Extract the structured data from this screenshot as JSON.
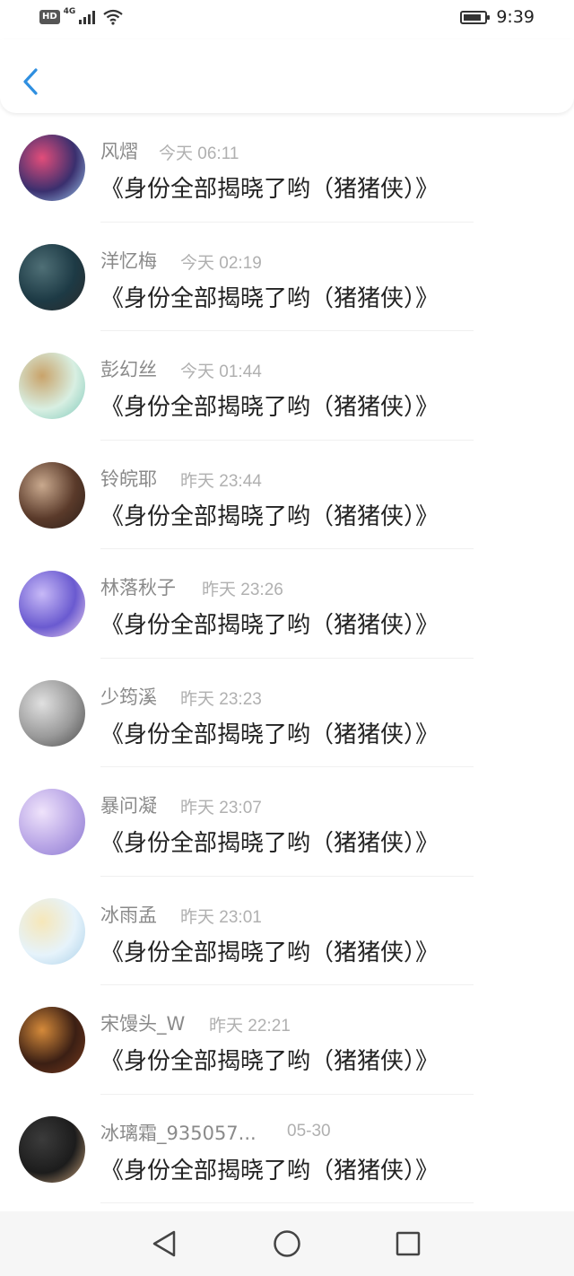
{
  "status_bar": {
    "hd_label": "HD",
    "network_type": "4G",
    "battery_level": 0.85,
    "time": "9:39"
  },
  "header": {
    "back_icon": "chevron-left-icon",
    "accent_color": "#2f8fe0"
  },
  "list": [
    {
      "name": "风熠",
      "time": "今天 06:11",
      "message": "《身份全部揭晓了哟（猪猪侠）》"
    },
    {
      "name": "洋忆梅",
      "time": "今天 02:19",
      "message": "《身份全部揭晓了哟（猪猪侠）》"
    },
    {
      "name": "彭幻丝",
      "time": "今天 01:44",
      "message": "《身份全部揭晓了哟（猪猪侠）》"
    },
    {
      "name": "铃皖耶",
      "time": "昨天 23:44",
      "message": "《身份全部揭晓了哟（猪猪侠）》"
    },
    {
      "name": "林落秋子",
      "time": "昨天 23:26",
      "message": "《身份全部揭晓了哟（猪猪侠）》"
    },
    {
      "name": "少筠溪",
      "time": "昨天 23:23",
      "message": "《身份全部揭晓了哟（猪猪侠）》"
    },
    {
      "name": "暴问凝",
      "time": "昨天 23:07",
      "message": "《身份全部揭晓了哟（猪猪侠）》"
    },
    {
      "name": "冰雨孟",
      "time": "昨天 23:01",
      "message": "《身份全部揭晓了哟（猪猪侠）》"
    },
    {
      "name": "宋馒头_W",
      "time": "昨天 22:21",
      "message": "《身份全部揭晓了哟（猪猪侠）》"
    },
    {
      "name": "冰璃霜_935057...",
      "time": "05-30",
      "message": "《身份全部揭晓了哟（猪猪侠）》"
    }
  ],
  "nav_bar": {
    "back_icon": "triangle-back-icon",
    "home_icon": "circle-home-icon",
    "recents_icon": "square-recents-icon"
  }
}
